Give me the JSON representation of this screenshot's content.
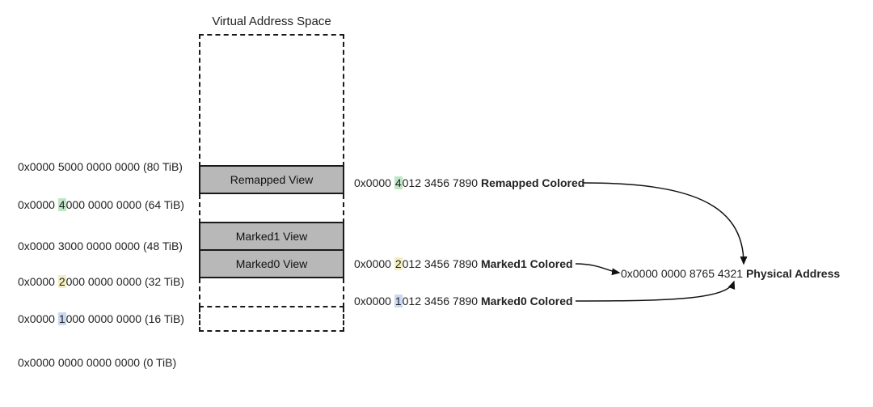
{
  "title": "Virtual Address Space",
  "addresses": {
    "a80": {
      "hex_pre": "0x0000 ",
      "hl": "5",
      "hex_post": "000 0000 0000 (80 TiB)"
    },
    "a64": {
      "hex_pre": "0x0000 ",
      "hl": "4",
      "hex_post": "000 0000 0000 (64 TiB)"
    },
    "a48": {
      "hex_pre": "0x0000 ",
      "hl": "3",
      "hex_post": "000 0000 0000 (48 TiB)"
    },
    "a32": {
      "hex_pre": "0x0000 ",
      "hl": "2",
      "hex_post": "000 0000 0000 (32 TiB)"
    },
    "a16": {
      "hex_pre": "0x0000 ",
      "hl": "1",
      "hex_post": "000 0000 0000 (16 TiB)"
    },
    "a0": {
      "hex_pre": "0x0000 ",
      "hl": "0",
      "hex_post": "000 0000 0000 (0 TiB)"
    }
  },
  "views": {
    "remapped": "Remapped View",
    "marked1": "Marked1 View",
    "marked0": "Marked0 View"
  },
  "colored": {
    "remapped": {
      "pre": "0x0000 ",
      "hl": "4",
      "mid": "012 3456 7890 ",
      "label": "Remapped Colored"
    },
    "marked1": {
      "pre": "0x0000 ",
      "hl": "2",
      "mid": "012 3456 7890 ",
      "label": "Marked1 Colored"
    },
    "marked0": {
      "pre": "0x0000 ",
      "hl": "1",
      "mid": "012 3456 7890 ",
      "label": "Marked0 Colored"
    }
  },
  "physical": {
    "text": "0x0000 0000 8765 4321 ",
    "label": "Physical Address"
  }
}
